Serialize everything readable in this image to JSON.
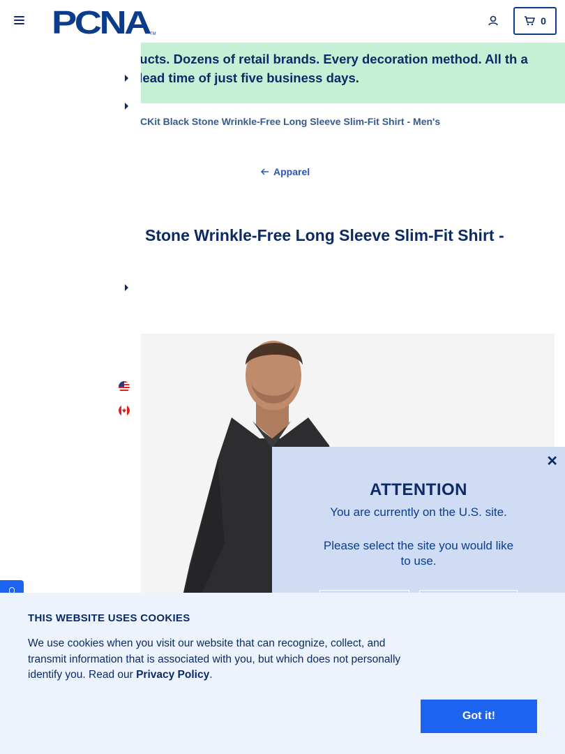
{
  "header": {
    "logo_text": "PCNA",
    "cart_count": "0"
  },
  "promo": {
    "text": "ls of products. Dozens of retail brands. Every decoration method. All th a standard lead time of just five business days."
  },
  "breadcrumb": {
    "current": "CKit Black Stone Wrinkle-Free Long Sleeve Slim-Fit Shirt - Men's"
  },
  "back_link": {
    "label": "Apparel"
  },
  "product": {
    "title": "Stone Wrinkle-Free Long Sleeve Slim-Fit Shirt -"
  },
  "modal": {
    "title": "ATTENTION",
    "line1": "You are currently on the U.S. site.",
    "line2": "Please select the site you would like to use."
  },
  "cookie": {
    "title": "THIS WEBSITE USES COOKIES",
    "text_before": "We use cookies when you visit our website that can recognize, collect, and transmit information that is associated with you, but which does not personally identify you. Read our ",
    "link": "Privacy Policy",
    "text_after": ".",
    "button": "Got it!"
  },
  "colors": {
    "brand_navy": "#0b2a66",
    "accent_blue": "#1c63f0",
    "promo_green": "#c6f0d6",
    "modal_bg": "#d0dcf3",
    "cookie_bg": "#edf3fd"
  }
}
